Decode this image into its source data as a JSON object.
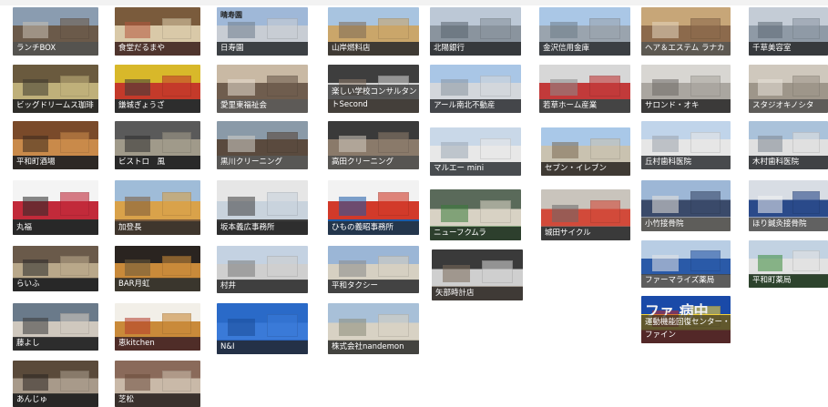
{
  "tiles": [
    {
      "label": "ランチBOX",
      "colors": [
        "#8a9cb0",
        "#6b5a4a",
        "#c9c1b5"
      ]
    },
    {
      "label": "食堂だるまや",
      "colors": [
        "#7a5b3c",
        "#d9c9a8",
        "#b4563d"
      ]
    },
    {
      "label": "日寿園",
      "colors": [
        "#9fb8d8",
        "#c8cdd4",
        "#6f7d8c"
      ],
      "overlay": "晴寿園"
    },
    {
      "label": "山岸燃料店",
      "colors": [
        "#a8c4e0",
        "#caa66a",
        "#7c6a55"
      ]
    },
    {
      "label": "北陽銀行",
      "colors": [
        "#bcc8d6",
        "#8a949e",
        "#5a6470"
      ]
    },
    {
      "label": "金沢信用金庫",
      "colors": [
        "#aac7e6",
        "#9aa4ae",
        "#6d7c88"
      ]
    },
    {
      "label": "ヘア＆エステム ラナカ",
      "colors": [
        "#c7a678",
        "#8c6a4c",
        "#e4d6bf"
      ]
    },
    {
      "label": "千草美容室",
      "colors": [
        "#c4ccd6",
        "#8f9aa6",
        "#5f6a74"
      ]
    },
    {
      "label": "ビッグドリームス珈琲",
      "colors": [
        "#6a5a3e",
        "#bfb07a",
        "#3e3a2e"
      ]
    },
    {
      "label": "鎌城ぎょうざ",
      "colors": [
        "#d8b82a",
        "#c43a2a",
        "#3a3a3a"
      ]
    },
    {
      "label": "愛里東福祉会",
      "colors": [
        "#c9b9a4",
        "#6f5d4e",
        "#e6dccf"
      ]
    },
    {
      "label": "楽しい学校コンサルタントSecond",
      "colors": [
        "#3e3e3e",
        "#cfcfcf",
        "#8e7a6a"
      ],
      "two": true
    },
    {
      "label": "アール南北不動産",
      "colors": [
        "#a9c6e6",
        "#d3d7dc",
        "#8b95a0"
      ]
    },
    {
      "label": "若草ホーム産業",
      "colors": [
        "#d7d7d7",
        "#c23a3a",
        "#8d8d8d"
      ]
    },
    {
      "label": "サロンド・オキ",
      "colors": [
        "#d8d6d2",
        "#aaa6a0",
        "#6d6a66"
      ]
    },
    {
      "label": "スタジオキノシタ",
      "colors": [
        "#cfc8bd",
        "#9e968a",
        "#e8e2d8"
      ]
    },
    {
      "label": "平和町酒場",
      "colors": [
        "#7a4a2a",
        "#c98a4a",
        "#3a2a1e"
      ]
    },
    {
      "label": "ビストロ　風",
      "colors": [
        "#5a5a5a",
        "#a09a8a",
        "#2e2e2e"
      ]
    },
    {
      "label": "黒川クリーニング",
      "colors": [
        "#8a9aa8",
        "#5a4a3e",
        "#d2cfc8"
      ]
    },
    {
      "label": "高田クリーニング",
      "colors": [
        "#3a3a3a",
        "#8a7a6a",
        "#cfc8be"
      ]
    },
    {
      "label": "マルエー mini",
      "colors": [
        "#c9d8e8",
        "#e8e8e8",
        "#9aa8b4"
      ]
    },
    {
      "label": "セブン・イレブン",
      "colors": [
        "#a9c8e8",
        "#c9c2b0",
        "#7a6a52"
      ]
    },
    {
      "label": "丘村歯科医院",
      "colors": [
        "#c0d4ea",
        "#e6e6e6",
        "#9aa3ac"
      ]
    },
    {
      "label": "木村歯科医院",
      "colors": [
        "#aac2da",
        "#e0e0e0",
        "#7d8791"
      ]
    },
    {
      "label": "丸福",
      "colors": [
        "#f4f4f4",
        "#c22a3a",
        "#2a2a2a"
      ]
    },
    {
      "label": "加登長",
      "colors": [
        "#9fbcd8",
        "#d9a24a",
        "#7a5a3a"
      ]
    },
    {
      "label": "坂本義広事務所",
      "colors": [
        "#e6e6e6",
        "#c9d3dd",
        "#3e3e3e"
      ]
    },
    {
      "label": "ひもの義昭事務所",
      "colors": [
        "#f2f2f2",
        "#d23a2a",
        "#1a5aa8"
      ]
    },
    {
      "label": "ニューフクムラ",
      "colors": [
        "#5a6a5a",
        "#d8d2c4",
        "#3a7a3a"
      ]
    },
    {
      "label": "城田サイクル",
      "colors": [
        "#c9c4bc",
        "#d24a3a",
        "#6a6a6a"
      ]
    },
    {
      "label": "小竹接骨院",
      "colors": [
        "#9db7d6",
        "#3a4a6a",
        "#e8e4dc"
      ]
    },
    {
      "label": "ほり鍼灸接骨院",
      "colors": [
        "#d8dde4",
        "#2a4a8a",
        "#f2f2f2"
      ]
    },
    {
      "label": "らいふ",
      "colors": [
        "#6a5a4a",
        "#b9a88a",
        "#2a2a2a"
      ]
    },
    {
      "label": "BAR月虹",
      "colors": [
        "#2a2420",
        "#c98a3a",
        "#6a5a3a"
      ]
    },
    {
      "label": "村井",
      "colors": [
        "#c4d2e2",
        "#cfcfcf",
        "#7a7a7a"
      ]
    },
    {
      "label": "平和タクシー",
      "colors": [
        "#9bb6d6",
        "#d6d0c2",
        "#8a8a8a"
      ]
    },
    {
      "label": "矢部時計店",
      "colors": [
        "#3a3a3a",
        "#cfcfcf",
        "#7a6a5a"
      ]
    },
    {
      "label": "ファーマライズ薬局",
      "colors": [
        "#b8cde4",
        "#2a5aa8",
        "#e6e6e6"
      ]
    },
    {
      "label": "平和町薬局",
      "colors": [
        "#c2d2e2",
        "#e2e2e2",
        "#3a8a3a"
      ]
    },
    {
      "label": "藤よし",
      "colors": [
        "#6a7a8a",
        "#cfc8be",
        "#3a3a3a"
      ]
    },
    {
      "label": "恵kitchen",
      "colors": [
        "#f2efe8",
        "#c98a3a",
        "#b23a2a"
      ]
    },
    {
      "label": "N&I",
      "colors": [
        "#2a6ac8",
        "#3a7ad8",
        "#1a4a98"
      ]
    },
    {
      "label": "株式会社nandemon",
      "colors": [
        "#a8c0d8",
        "#d8d2c4",
        "#8a8a7a"
      ]
    },
    {
      "label": "運動機能回復センター・ファイン",
      "colors": [
        "#1a4aa8",
        "#f2d23a",
        "#c22a2a"
      ],
      "two": true,
      "overlay": "ファ 病中"
    },
    {
      "label": "あんじゅ",
      "colors": [
        "#5a4a3a",
        "#a89a8a",
        "#2a2420"
      ]
    },
    {
      "label": "芝松",
      "colors": [
        "#8a6a5a",
        "#c9b9a8",
        "#6a4a3a"
      ]
    }
  ]
}
